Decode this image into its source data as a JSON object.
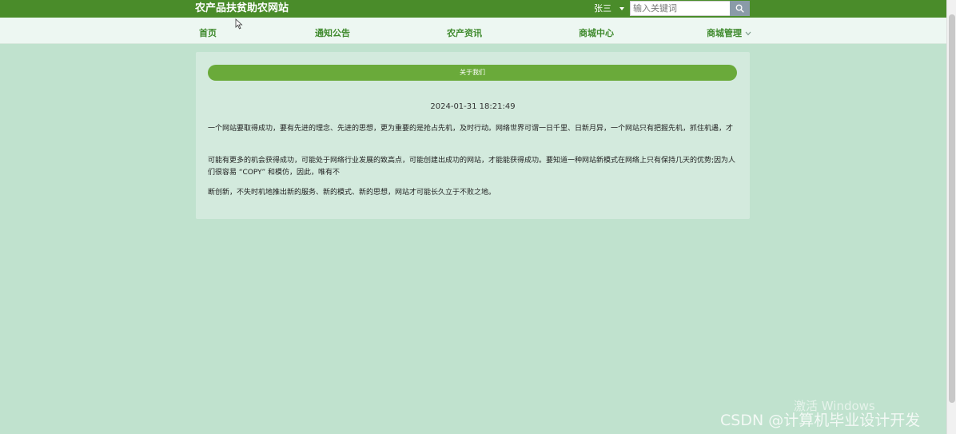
{
  "header": {
    "site_title": "农产品扶贫助农网站",
    "user_name": "张三",
    "search_placeholder": "输入关键词"
  },
  "nav": {
    "items": [
      {
        "label": "首页"
      },
      {
        "label": "通知公告"
      },
      {
        "label": "农产资讯"
      },
      {
        "label": "商城中心"
      },
      {
        "label": "商城管理"
      }
    ]
  },
  "content": {
    "section_title": "关于我们",
    "date": "2024-01-31 18:21:49",
    "paragraphs": [
      "一个网站要取得成功，要有先进的理念、先进的思想，更为重要的是抢占先机，及时行动。网络世界可谓一日千里、日新月异，一个网站只有把握先机，抓住机遇，才",
      "可能有更多的机会获得成功，可能处于网络行业发展的致高点，可能创建出成功的网站，才能能获得成功。要知道一种网站新模式在网络上只有保持几天的优势;因为人们很容易 “COPY” 和模仿，因此，唯有不",
      "断创新，不失时机地推出新的服务、新的模式、新的思想，网站才可能长久立于不败之地。"
    ]
  },
  "watermarks": {
    "windows": "激活 Windows",
    "csdn": "CSDN @计算机毕业设计开发"
  },
  "colors": {
    "header_bg": "#4a8c2a",
    "nav_bg": "#edf7f2",
    "page_bg": "#c0e2ce",
    "card_bg": "#d3eadd",
    "accent": "#6aaa3a",
    "nav_text": "#3f8a2d"
  },
  "icons": {
    "search": "search-icon",
    "user_caret": "caret-down-icon",
    "nav_chevron": "chevron-down-icon"
  }
}
